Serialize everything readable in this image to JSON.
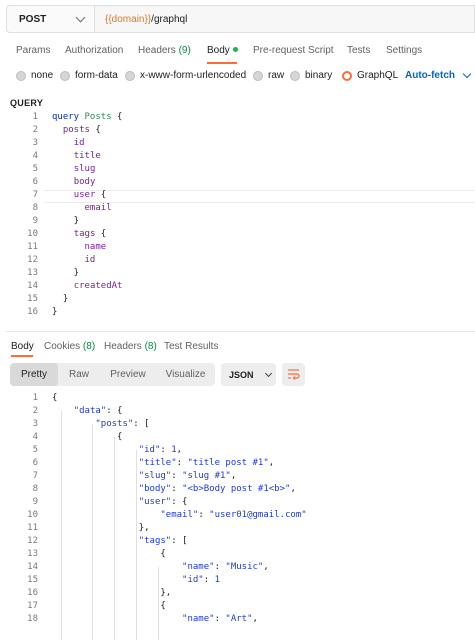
{
  "request": {
    "method": "POST",
    "url_variable": "{{domain}}",
    "url_path": "/graphql"
  },
  "request_tabs": [
    {
      "label": "Params"
    },
    {
      "label": "Authorization"
    },
    {
      "label": "Headers",
      "count": "(9)"
    },
    {
      "label": "Body",
      "active": true
    },
    {
      "label": "Pre-request Script"
    },
    {
      "label": "Tests"
    },
    {
      "label": "Settings"
    }
  ],
  "body_types": {
    "options": [
      "none",
      "form-data",
      "x-www-form-urlencoded",
      "raw",
      "binary",
      "GraphQL"
    ],
    "selected": "GraphQL",
    "auto_fetch": "Auto-fetch"
  },
  "query_section": {
    "label": "QUERY",
    "line_numbers": [
      "1",
      "2",
      "3",
      "4",
      "5",
      "6",
      "7",
      "8",
      "9",
      "10",
      "11",
      "12",
      "13",
      "14",
      "15",
      "16"
    ],
    "lines": [
      "query Posts {",
      "  posts {",
      "    id",
      "    title",
      "    slug",
      "    body",
      "    user {",
      "      email",
      "    }",
      "    tags {",
      "      name",
      "      id",
      "    }",
      "    createdAt",
      "  }",
      "}"
    ]
  },
  "response_tabs": [
    {
      "label": "Body",
      "active": true
    },
    {
      "label": "Cookies",
      "count": "(8)"
    },
    {
      "label": "Headers",
      "count": "(8)"
    },
    {
      "label": "Test Results"
    }
  ],
  "response_view": {
    "modes": [
      "Pretty",
      "Raw",
      "Preview",
      "Visualize"
    ],
    "active_mode": "Pretty",
    "format": "JSON",
    "wrap_icon": "wrap-lines-icon"
  },
  "response_body": {
    "line_numbers": [
      "1",
      "2",
      "3",
      "4",
      "5",
      "6",
      "7",
      "8",
      "9",
      "10",
      "11",
      "12",
      "13",
      "14",
      "15",
      "16",
      "17",
      "18"
    ],
    "lines": [
      "{",
      "    \"data\": {",
      "        \"posts\": [",
      "            {",
      "                \"id\": 1,",
      "                \"title\": \"title post #1\",",
      "                \"slug\": \"slug #1\",",
      "                \"body\": \"<b>Body post #1<b>\",",
      "                \"user\": {",
      "                    \"email\": \"user01@gmail.com\"",
      "                },",
      "                \"tags\": [",
      "                    {",
      "                        \"name\": \"Music\",",
      "                        \"id\": 1",
      "                    },",
      "                    {",
      "                        \"name\": \"Art\","
    ]
  },
  "colors": {
    "accent": "#ff6c37",
    "link_blue": "#0265d2",
    "count_green": "#0c8a3d",
    "url_variable": "#e07b2a"
  }
}
